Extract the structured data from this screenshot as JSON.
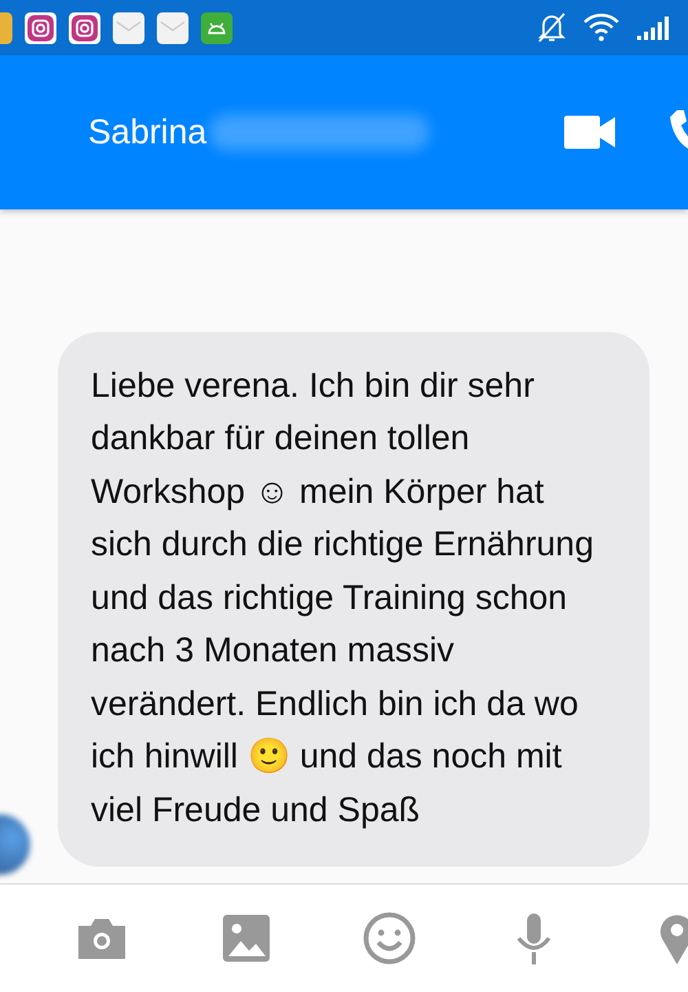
{
  "status_bar": {
    "notifications": [
      {
        "kind": "app"
      },
      {
        "kind": "instagram"
      },
      {
        "kind": "instagram"
      },
      {
        "kind": "mail"
      },
      {
        "kind": "mail"
      },
      {
        "kind": "android"
      }
    ]
  },
  "header": {
    "title": "Sabrina"
  },
  "messages": [
    {
      "text": "Liebe verena. Ich bin dir sehr dankbar für deinen tollen Workshop ☺ mein Körper hat sich durch die richtige Ernährung und das richtige Training schon nach 3 Monaten massiv verändert. Endlich bin ich da wo ich hinwill 🙂 und das noch mit viel Freude und Spaß"
    }
  ],
  "composer": {
    "tools": [
      {
        "kind": "camera"
      },
      {
        "kind": "gallery"
      },
      {
        "kind": "emoji"
      },
      {
        "kind": "microphone"
      },
      {
        "kind": "location"
      }
    ]
  }
}
